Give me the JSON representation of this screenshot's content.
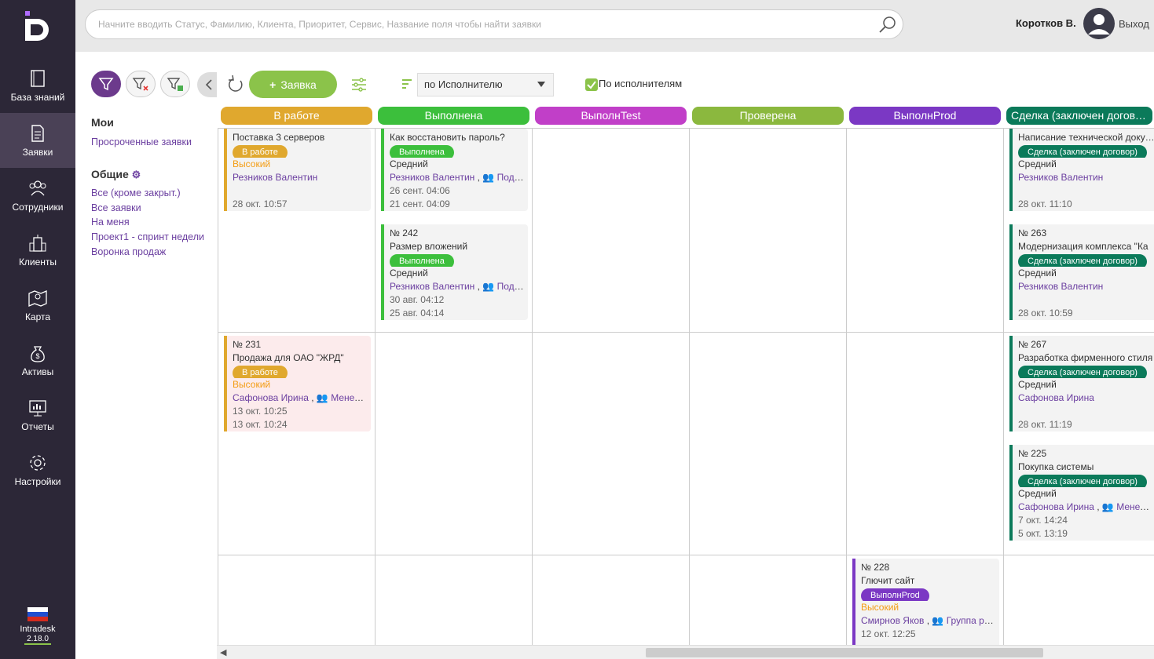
{
  "sidebar": {
    "items": [
      {
        "label": "База знаний",
        "icon": "book-icon"
      },
      {
        "label": "Заявки",
        "icon": "document-icon"
      },
      {
        "label": "Сотрудники",
        "icon": "users-icon"
      },
      {
        "label": "Клиенты",
        "icon": "building-icon"
      },
      {
        "label": "Карта",
        "icon": "map-icon"
      },
      {
        "label": "Активы",
        "icon": "money-bag-icon"
      },
      {
        "label": "Отчеты",
        "icon": "chart-icon"
      },
      {
        "label": "Настройки",
        "icon": "gear-icon"
      }
    ],
    "brand": "Intradesk",
    "version": "2.18.0"
  },
  "search": {
    "placeholder": "Начните вводить Статус, Фамилию, Клиента, Приоритет, Сервис, Название поля чтобы найти заявки"
  },
  "user": {
    "name": "Коротков В.",
    "logout": "Выход"
  },
  "filters": {
    "mine_title": "Мои",
    "mine": [
      "Просроченные заявки"
    ],
    "common_title": "Общие",
    "common": [
      "Все (кроме закрыт.)",
      "Все заявки",
      "На меня",
      "Проект1 - спринт недели",
      "Воронка продаж"
    ]
  },
  "toolbar": {
    "new_label": "Заявка",
    "group_select": "по Исполнителю",
    "checkbox_label": "По исполнителям"
  },
  "columns": [
    {
      "label": "В работе",
      "color": "#e0a82e"
    },
    {
      "label": "Выполнена",
      "color": "#3cbf3c"
    },
    {
      "label": "ВыполнTest",
      "color": "#c13fc8"
    },
    {
      "label": "Проверена",
      "color": "#8bb83e"
    },
    {
      "label": "ВыполнProd",
      "color": "#7b38c4"
    },
    {
      "label": "Сделка (заключен договор)",
      "color": "#0b7a5a"
    }
  ],
  "cards": [
    {
      "col": 0,
      "row": 0,
      "lines": [
        "Поставка 3 серверов"
      ],
      "status": "В работе",
      "priority": "Высокий",
      "person": "Резников Валентин",
      "group": "",
      "dates": [
        "",
        "28 окт. 10:57"
      ]
    },
    {
      "col": 1,
      "row": 0,
      "lines": [
        "Как восстановить пароль?"
      ],
      "status": "Выполнена",
      "priority": "Средний",
      "person": "Резников Валентин",
      "group": "Поддержка",
      "dates": [
        "26 сент. 04:06",
        "21 сент. 04:09"
      ]
    },
    {
      "col": 1,
      "row": 1,
      "lines": [
        "№ 242",
        "Размер вложений"
      ],
      "status": "Выполнена",
      "priority": "Средний",
      "person": "Резников Валентин",
      "group": "Поддержка",
      "dates": [
        "30 авг. 04:12",
        "25 авг. 04:14"
      ]
    },
    {
      "col": 5,
      "row": 0,
      "lines": [
        "Написание технической документации"
      ],
      "status": "Сделка (заключен договор)",
      "priority": "Средний",
      "person": "Резников Валентин",
      "group": "",
      "dates": [
        "",
        "28 окт. 11:10"
      ]
    },
    {
      "col": 5,
      "row": 1,
      "lines": [
        "№ 263",
        "Модернизация комплекса \"Ка"
      ],
      "status": "Сделка (заключен договор)",
      "priority": "Средний",
      "person": "Резников Валентин",
      "group": "",
      "dates": [
        "",
        "28 окт. 10:59"
      ]
    },
    {
      "col": 0,
      "row": 2,
      "lines": [
        "№ 231",
        "Продажа для ОАО \"ЖРД\""
      ],
      "status": "В работе",
      "priority": "Высокий",
      "person": "Сафонова Ирина",
      "group": "Менеджеры",
      "dates": [
        "13 окт. 10:25",
        "13 окт. 10:24"
      ]
    },
    {
      "col": 5,
      "row": 2,
      "lines": [
        "№ 267",
        "Разработка фирменного стиля"
      ],
      "status": "Сделка (заключен договор)",
      "priority": "Средний",
      "person": "Сафонова Ирина",
      "group": "",
      "dates": [
        "",
        "28 окт. 11:19"
      ]
    },
    {
      "col": 5,
      "row": 3,
      "lines": [
        "№ 225",
        "Покупка системы"
      ],
      "status": "Сделка (заключен договор)",
      "priority": "Средний",
      "person": "Сафонова Ирина",
      "group": "Менеджеры",
      "dates": [
        "7 окт. 14:24",
        "5 окт. 13:19"
      ]
    },
    {
      "col": 4,
      "row": 4,
      "lines": [
        "№ 228",
        "Глючит сайт"
      ],
      "status": "ВыполнProd",
      "priority": "Высокий",
      "person": "Смирнов Яков",
      "group": "Группа разработки",
      "dates": [
        "12 окт. 12:25",
        ""
      ]
    }
  ]
}
